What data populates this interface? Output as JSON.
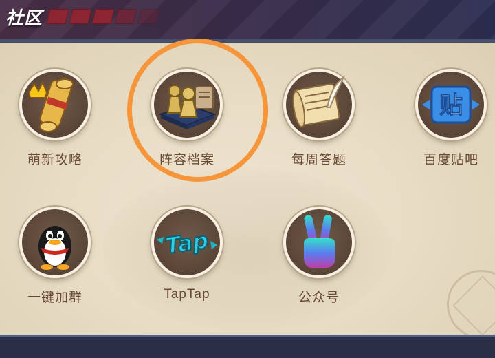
{
  "header": {
    "title": "社区"
  },
  "grid": {
    "items": [
      {
        "label": "萌新攻略",
        "icon": "scroll-crown-icon"
      },
      {
        "label": "阵容档案",
        "icon": "chess-pawn-icon"
      },
      {
        "label": "每周答题",
        "icon": "quill-scroll-icon"
      },
      {
        "label": "百度贴吧",
        "icon": "tieba-icon",
        "glyph": "贴"
      },
      {
        "label": "一键加群",
        "icon": "qq-penguin-icon"
      },
      {
        "label": "TapTap",
        "icon": "taptap-icon",
        "glyph": "Tap"
      },
      {
        "label": "公众号",
        "icon": "victory-hand-icon"
      }
    ]
  },
  "colors": {
    "header_accent": "#8c2432",
    "panel_bg": "#e7dcc4",
    "label_text": "#6a4a36",
    "highlight_circle": "#f7953a"
  }
}
